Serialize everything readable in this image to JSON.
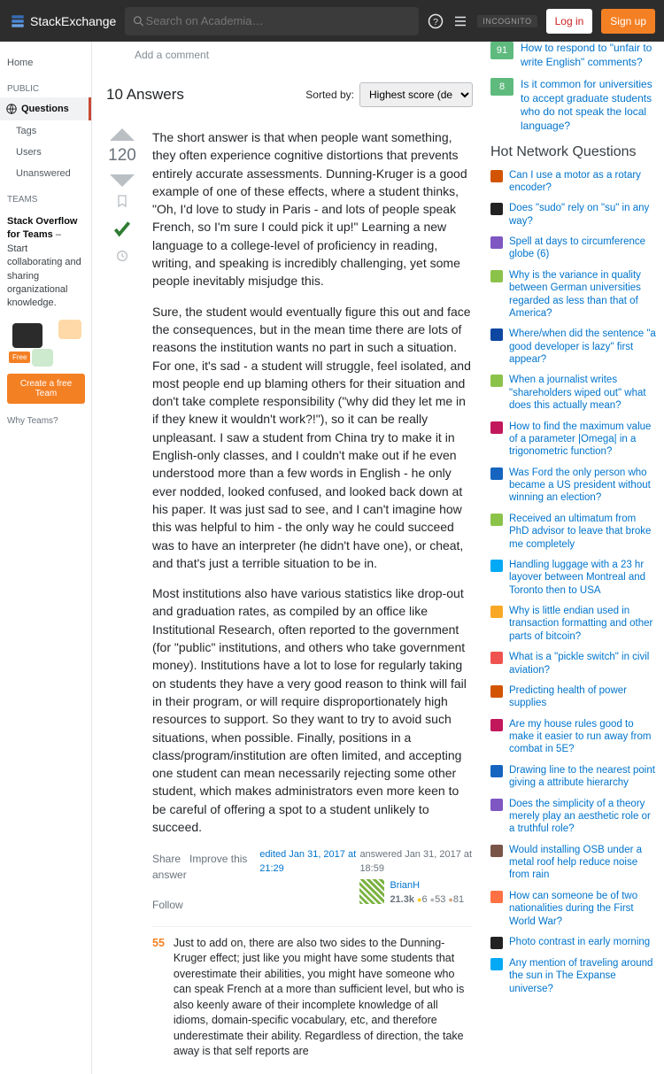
{
  "topbar": {
    "logo_text": "StackExchange",
    "search_placeholder": "Search on Academia…",
    "incognito": "INCOGNITO",
    "login": "Log in",
    "signup": "Sign up"
  },
  "leftnav": {
    "home": "Home",
    "public": "PUBLIC",
    "questions": "Questions",
    "tags": "Tags",
    "users": "Users",
    "unanswered": "Unanswered",
    "teams": "TEAMS",
    "teams_blurb_bold": "Stack Overflow for Teams",
    "teams_blurb_rest": " – Start collaborating and sharing organizational knowledge.",
    "free_badge": "Free",
    "create_team": "Create a free Team",
    "why_teams": "Why Teams?"
  },
  "main": {
    "add_comment": "Add a comment",
    "answers_count": "10 Answers",
    "sorted_by": "Sorted by:",
    "sort_selected": "Highest score (default)",
    "vote_count": "120",
    "paragraphs": [
      "The short answer is that when people want something, they often experience cognitive distortions that prevents entirely accurate assessments. Dunning-Kruger is a good example of one of these effects, where a student thinks, \"Oh, I'd love to study in Paris - and lots of people speak French, so I'm sure I could pick it up!\" Learning a new language to a college-level of proficiency in reading, writing, and speaking is incredibly challenging, yet some people inevitably misjudge this.",
      "Sure, the student would eventually figure this out and face the consequences, but in the mean time there are lots of reasons the institution wants no part in such a situation. For one, it's sad - a student will struggle, feel isolated, and most people end up blaming others for their situation and don't take complete responsibility (\"why did they let me in if they knew it wouldn't work?!\"), so it can be really unpleasant. I saw a student from China try to make it in English-only classes, and I couldn't make out if he even understood more than a few words in English - he only ever nodded, looked confused, and looked back down at his paper. It was just sad to see, and I can't imagine how this was helpful to him - the only way he could succeed was to have an interpreter (he didn't have one), or cheat, and that's just a terrible situation to be in.",
      "Most institutions also have various statistics like drop-out and graduation rates, as compiled by an office like Institutional Research, often reported to the government (for \"public\" institutions, and others who take government money). Institutions have a lot to lose for regularly taking on students they have a very good reason to think will fail in their program, or will require disproportionately high resources to support. So they want to try to avoid such situations, when possible. Finally, positions in a class/program/institution are often limited, and accepting one student can mean necessarily rejecting some other student, which makes administrators even more keen to be careful of offering a spot to a student unlikely to succeed."
    ],
    "share": "Share",
    "improve": "Improve this answer",
    "follow": "Follow",
    "edited": "edited Jan 31, 2017 at 21:29",
    "answered": "answered Jan 31, 2017 at 18:59",
    "username": "BrianH",
    "rep": "21.3k",
    "gold": "6",
    "silver": "53",
    "bronze": "81",
    "comment_score": "55",
    "comment_text": "Just to add on, there are also two sides to the Dunning-Kruger effect; just like you might have some students that overestimate their abilities, you might have someone who can speak French at a more than sufficient level, but who is also keenly aware of their incomplete knowledge of all idioms, domain-specific vocabulary, etc, and therefore underestimate their ability. Regardless of direction, the take away is that self reports are"
  },
  "linked": [
    {
      "count": "91",
      "title": "How to respond to \"unfair to write English\" comments?"
    },
    {
      "count": "8",
      "title": "Is it common for universities to accept graduate students who do not speak the local language?"
    }
  ],
  "hot_header": "Hot Network Questions",
  "hot": [
    {
      "c": "#d35400",
      "t": "Can I use a motor as a rotary encoder?"
    },
    {
      "c": "#222",
      "t": "Does \"sudo\" rely on \"su\" in any way?"
    },
    {
      "c": "#7e57c2",
      "t": "Spell at days to circumference globe (6)"
    },
    {
      "c": "#8bc34a",
      "t": "Why is the variance in quality between German universities regarded as less than that of America?"
    },
    {
      "c": "#0d47a1",
      "t": "Where/when did the sentence \"a good developer is lazy\" first appear?"
    },
    {
      "c": "#8bc34a",
      "t": "When a journalist writes \"shareholders wiped out\" what does this actually mean?"
    },
    {
      "c": "#c2185b",
      "t": "How to find the maximum value of a parameter |Omega| in a trigonometric function?"
    },
    {
      "c": "#1565c0",
      "t": "Was Ford the only person who became a US president without winning an election?"
    },
    {
      "c": "#8bc34a",
      "t": "Received an ultimatum from PhD advisor to leave that broke me completely"
    },
    {
      "c": "#03a9f4",
      "t": "Handling luggage with a 23 hr layover between Montreal and Toronto then to USA"
    },
    {
      "c": "#f9a825",
      "t": "Why is little endian used in transaction formatting and other parts of bitcoin?"
    },
    {
      "c": "#ef5350",
      "t": "What is a \"pickle switch\" in civil aviation?"
    },
    {
      "c": "#d35400",
      "t": "Predicting health of power supplies"
    },
    {
      "c": "#c2185b",
      "t": "Are my house rules good to make it easier to run away from combat in 5E?"
    },
    {
      "c": "#1565c0",
      "t": "Drawing line to the nearest point giving a attribute hierarchy"
    },
    {
      "c": "#7e57c2",
      "t": "Does the simplicity of a theory merely play an aesthetic role or a truthful role?"
    },
    {
      "c": "#795548",
      "t": "Would installing OSB under a metal roof help reduce noise from rain"
    },
    {
      "c": "#ff7043",
      "t": "How can someone be of two nationalities during the First World War?"
    },
    {
      "c": "#222",
      "t": "Photo contrast in early morning"
    },
    {
      "c": "#03a9f4",
      "t": "Any mention of traveling around the sun in The Expanse universe?"
    }
  ]
}
